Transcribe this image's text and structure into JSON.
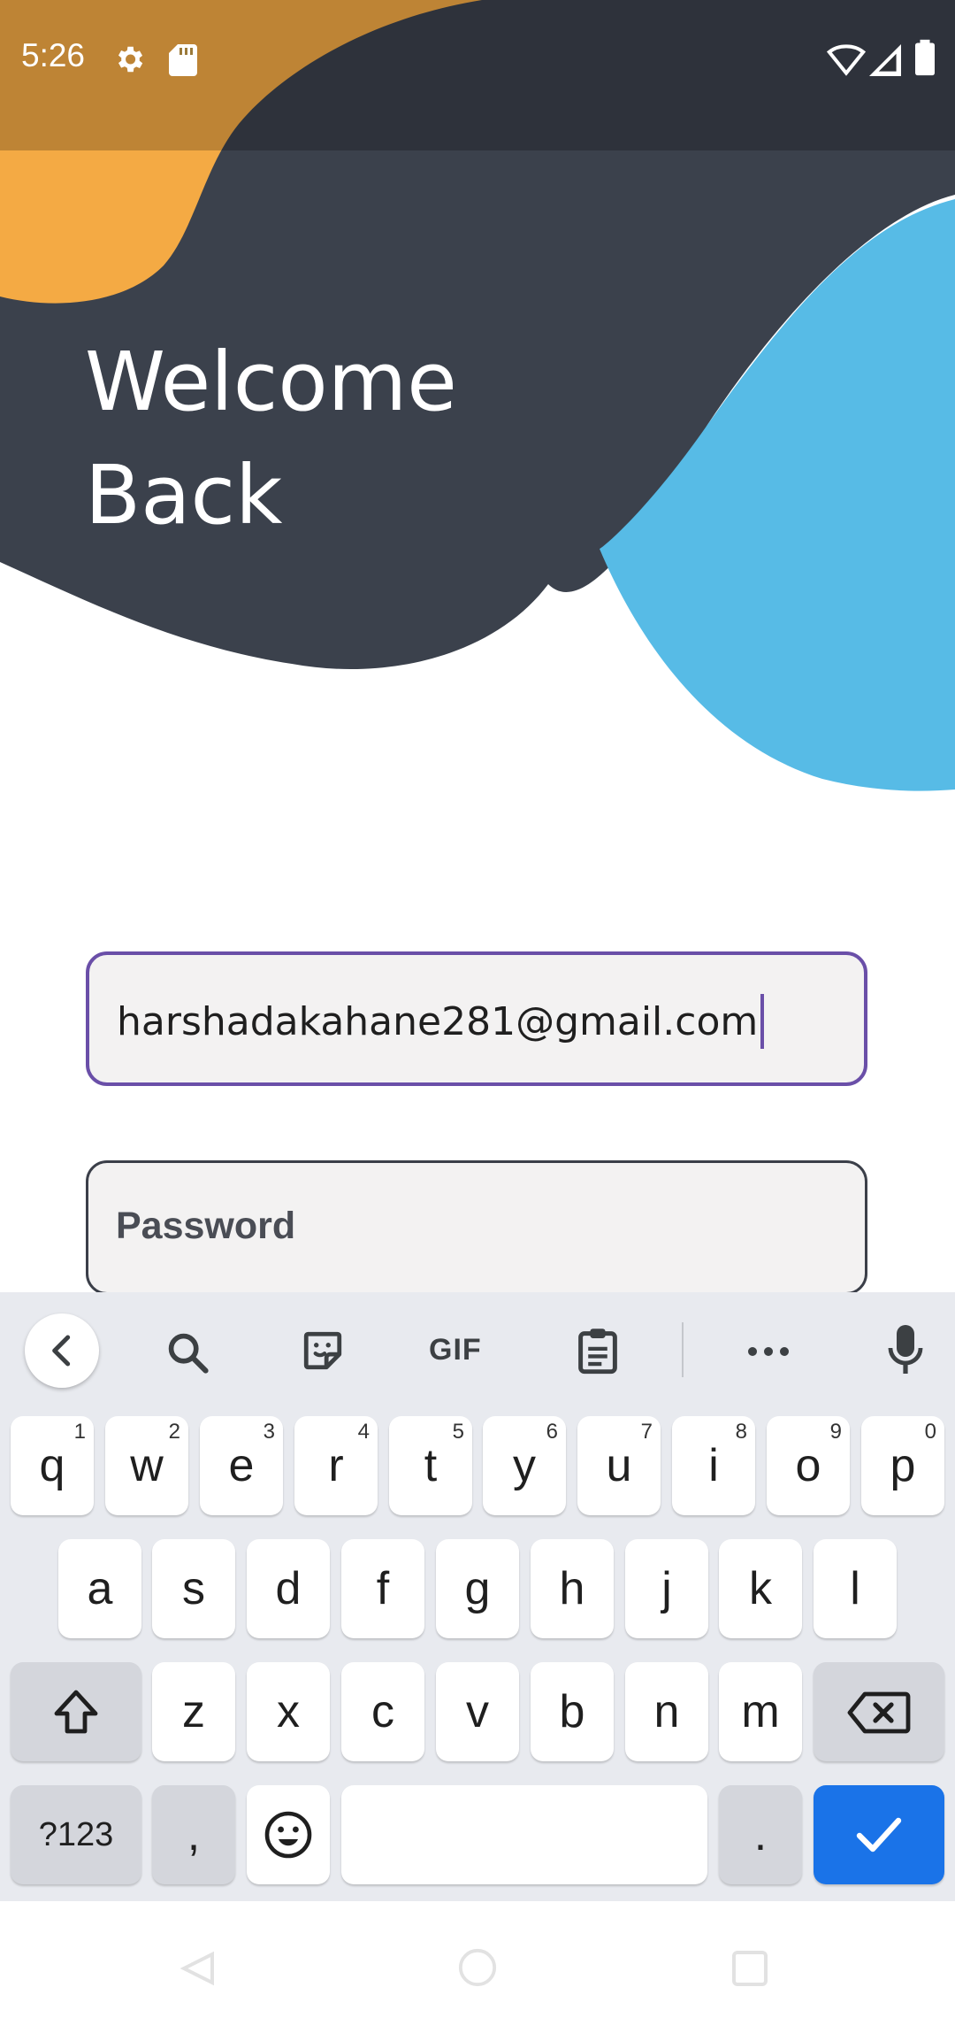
{
  "status_bar": {
    "time": "5:26"
  },
  "welcome": {
    "line1": "Welcome",
    "line2": "Back"
  },
  "form": {
    "email_value": "harshadakahane281@gmail.com",
    "password_placeholder": "Password"
  },
  "colors": {
    "dark": "#3b414c",
    "orange": "#f4aa44",
    "blue": "#57bbe6",
    "field_focus": "#6a4fa8",
    "keyboard_bg": "#e8eaef",
    "enter_key": "#1a73e8"
  },
  "keyboard": {
    "toolbar": [
      "back-chevron-icon",
      "search-icon",
      "sticker-icon",
      "gif-icon",
      "clipboard-icon",
      "more-icon",
      "mic-icon"
    ],
    "gif_label": "GIF",
    "row1": [
      {
        "label": "q",
        "hint": "1"
      },
      {
        "label": "w",
        "hint": "2"
      },
      {
        "label": "e",
        "hint": "3"
      },
      {
        "label": "r",
        "hint": "4"
      },
      {
        "label": "t",
        "hint": "5"
      },
      {
        "label": "y",
        "hint": "6"
      },
      {
        "label": "u",
        "hint": "7"
      },
      {
        "label": "i",
        "hint": "8"
      },
      {
        "label": "o",
        "hint": "9"
      },
      {
        "label": "p",
        "hint": "0"
      }
    ],
    "row2": [
      "a",
      "s",
      "d",
      "f",
      "g",
      "h",
      "j",
      "k",
      "l"
    ],
    "row3": [
      "z",
      "x",
      "c",
      "v",
      "b",
      "n",
      "m"
    ],
    "symbols_label": "?123",
    "comma_label": ",",
    "period_label": "."
  },
  "nav_bar": [
    "back-icon",
    "home-icon",
    "recents-icon"
  ]
}
